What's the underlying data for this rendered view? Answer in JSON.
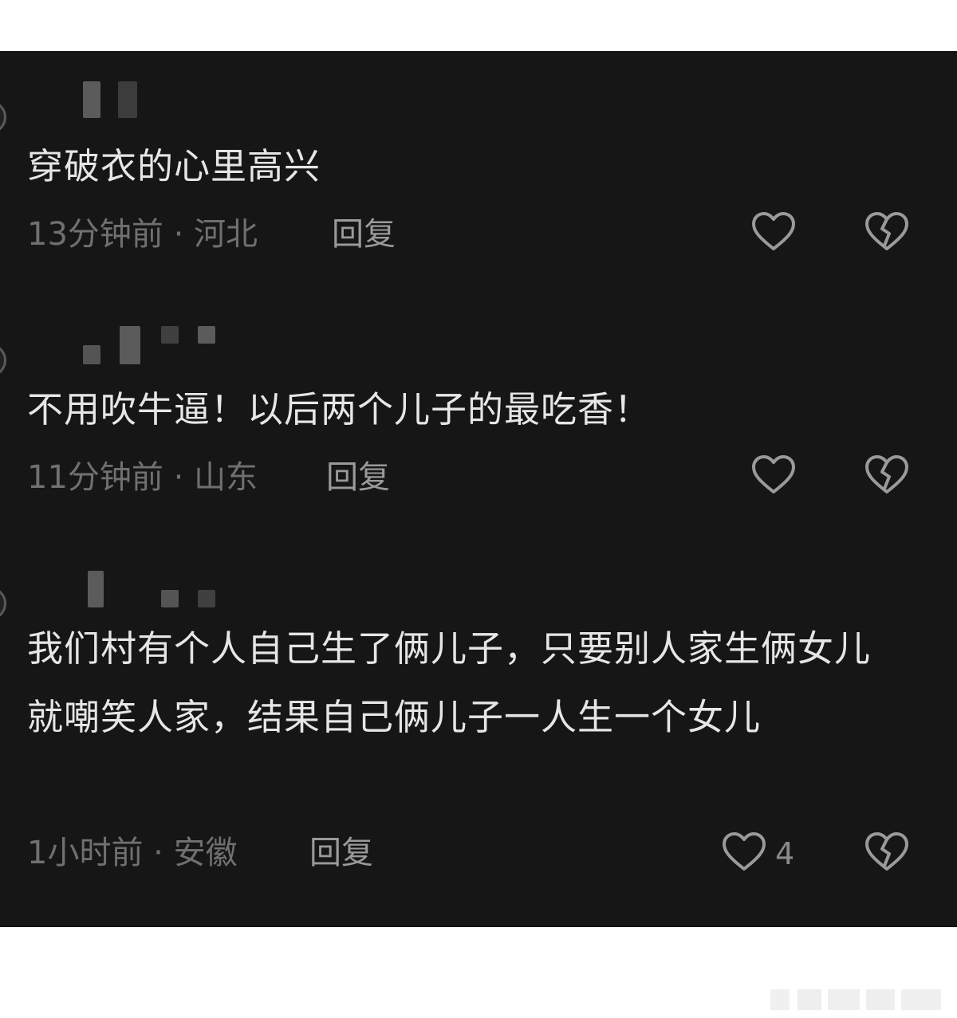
{
  "comments": [
    {
      "text": "穿破衣的心里高兴",
      "time": "13分钟前",
      "location": "河北",
      "reply": "回复",
      "likes": ""
    },
    {
      "text": "不用吹牛逼！以后两个儿子的最吃香！",
      "time": "11分钟前",
      "location": "山东",
      "reply": "回复",
      "likes": ""
    },
    {
      "text": "我们村有个人自己生了俩儿子，只要别人家生俩女儿就嘲笑人家，结果自己俩儿子一人生一个女儿",
      "time": "1小时前",
      "location": "安徽",
      "reply": "回复",
      "likes": "4"
    }
  ],
  "meta_separator": " · ",
  "icons": {
    "like": "heart-outline-icon",
    "dislike": "broken-heart-icon"
  },
  "colors": {
    "background": "#161616",
    "comment_text": "#e6e6e6",
    "meta_text": "#707070",
    "reply_text": "#9a9a9a",
    "icon": "#9a9a9a"
  }
}
